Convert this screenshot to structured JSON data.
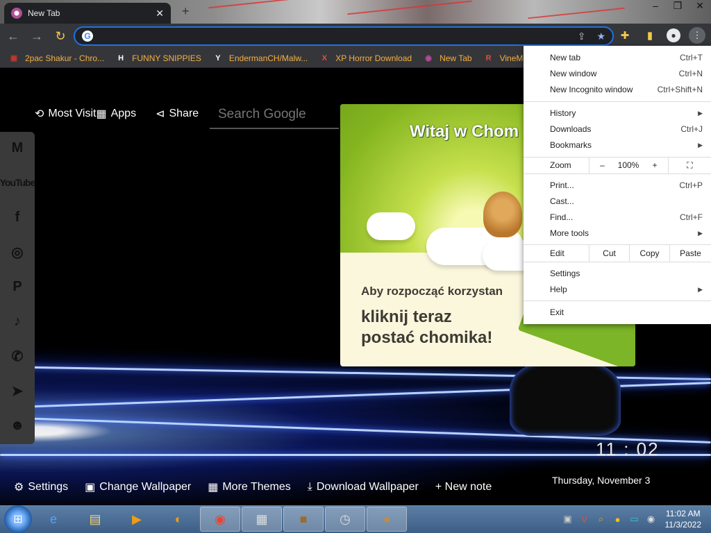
{
  "tab": {
    "title": "New Tab",
    "close": "✕"
  },
  "window_controls": {
    "minimize": "–",
    "restore": "❐",
    "close": "✕"
  },
  "omnibox": {
    "value": "",
    "placeholder": ""
  },
  "bookmarks": [
    {
      "label": "2pac Shakur - Chro...",
      "icon": "2pac-icon",
      "glyph": "▣",
      "color": "#c0392b"
    },
    {
      "label": "FUNNY SNIPPIES",
      "icon": "h-logo-icon",
      "glyph": "H",
      "color": "#ffffff"
    },
    {
      "label": "EndermanCH/Malw...",
      "icon": "yp-logo-icon",
      "glyph": "Y",
      "color": "#ffffff"
    },
    {
      "label": "XP Horror Download",
      "icon": "x-logo-icon",
      "glyph": "X",
      "color": "#e74c3c"
    },
    {
      "label": "New Tab",
      "icon": "newtab-favicon-icon",
      "glyph": "◉",
      "color": "#b84a9a"
    },
    {
      "label": "VineMEM",
      "icon": "r-logo-icon",
      "glyph": "R",
      "color": "#e74c3c"
    }
  ],
  "newtab": {
    "most_visited": "Most Visit",
    "apps": "Apps",
    "share": "Share",
    "search_placeholder": "Search Google",
    "clock": "11 : 02",
    "date": "Thursday, November 3",
    "bottom": {
      "settings": "Settings",
      "change_wallpaper": "Change Wallpaper",
      "more_themes": "More Themes",
      "download_wallpaper": "Download Wallpaper",
      "new_note": "+ New note"
    }
  },
  "promo": {
    "heading": "Witaj w Chom",
    "line1": "Aby rozpocząć korzystan",
    "line2a": "kliknij teraz",
    "line2b": "postać chomika!"
  },
  "menu": {
    "new_tab": {
      "label": "New tab",
      "shortcut": "Ctrl+T"
    },
    "new_window": {
      "label": "New window",
      "shortcut": "Ctrl+N"
    },
    "incognito": {
      "label": "New Incognito window",
      "shortcut": "Ctrl+Shift+N"
    },
    "history": {
      "label": "History"
    },
    "downloads": {
      "label": "Downloads",
      "shortcut": "Ctrl+J"
    },
    "bookmarks": {
      "label": "Bookmarks"
    },
    "zoom": {
      "label": "Zoom",
      "minus": "–",
      "value": "100%",
      "plus": "+"
    },
    "print": {
      "label": "Print...",
      "shortcut": "Ctrl+P"
    },
    "cast": {
      "label": "Cast..."
    },
    "find": {
      "label": "Find...",
      "shortcut": "Ctrl+F"
    },
    "more_tools": {
      "label": "More tools"
    },
    "edit": {
      "label": "Edit",
      "cut": "Cut",
      "copy": "Copy",
      "paste": "Paste"
    },
    "settings": {
      "label": "Settings"
    },
    "help": {
      "label": "Help"
    },
    "exit": {
      "label": "Exit"
    }
  },
  "taskbar": {
    "apps": [
      {
        "name": "ie-icon",
        "glyph": "e",
        "active": false
      },
      {
        "name": "file-explorer-icon",
        "glyph": "▤",
        "active": false
      },
      {
        "name": "media-player-icon",
        "glyph": "▶",
        "active": false
      },
      {
        "name": "uc-browser-icon",
        "glyph": "◐",
        "active": false
      },
      {
        "name": "chrome-icon",
        "glyph": "◉",
        "active": true
      },
      {
        "name": "app-window-icon",
        "glyph": "▦",
        "active": true
      },
      {
        "name": "hamster-box-icon",
        "glyph": "■",
        "active": true
      },
      {
        "name": "clock-app-icon",
        "glyph": "◷",
        "active": true
      },
      {
        "name": "hamster-app-icon",
        "glyph": "●",
        "active": true
      }
    ],
    "time": "11:02 AM",
    "date": "11/3/2022"
  },
  "colors": {
    "accent": "#1a73e8",
    "bookmark_text": "#f5b041",
    "promo_green": "#7cb527"
  }
}
